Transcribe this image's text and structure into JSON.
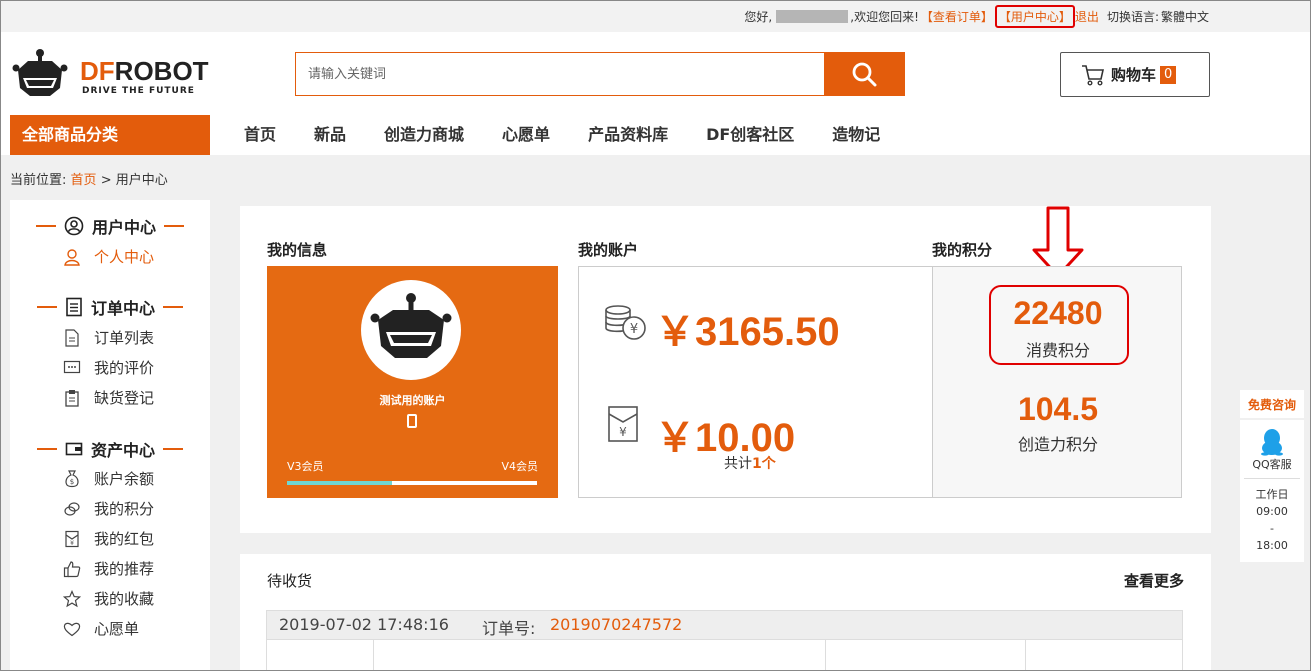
{
  "topbar": {
    "greeting": "您好,",
    "welcome": ",欢迎您回来!",
    "view_orders": "【查看订单】",
    "user_center": "【用户中心】",
    "logout": "退出",
    "switch_lang": "切换语言:",
    "lang": "繁體中文"
  },
  "header": {
    "logo_df": "DF",
    "logo_robot": "ROBOT",
    "logo_tagline": "DRIVE THE FUTURE",
    "search_placeholder": "请输入关键词",
    "cart_label": "购物车",
    "cart_count": "0"
  },
  "nav": {
    "category": "全部商品分类",
    "items": [
      "首页",
      "新品",
      "创造力商城",
      "心愿单",
      "产品资料库",
      "DF创客社区",
      "造物记"
    ]
  },
  "breadcrumb": {
    "prefix": "当前位置:",
    "home": "首页",
    "sep": ">",
    "current": "用户中心"
  },
  "sidebar": {
    "user_center": {
      "title": "用户中心",
      "items": [
        "个人中心"
      ]
    },
    "order_center": {
      "title": "订单中心",
      "items": [
        "订单列表",
        "我的评价",
        "缺货登记"
      ]
    },
    "asset_center": {
      "title": "资产中心",
      "items": [
        "账户余额",
        "我的积分",
        "我的红包",
        "我的推荐",
        "我的收藏",
        "心愿单"
      ]
    }
  },
  "my_info": {
    "title": "我的信息",
    "account_name": "测试用的账户",
    "level_current": "V3会员",
    "level_next": "V4会员",
    "level_progress_fraction": 0.42
  },
  "my_account": {
    "title": "我的账户",
    "balance": "￥3165.50",
    "coupon_amount": "￥10.00",
    "coupon_total_prefix": "共计",
    "coupon_count": "1个"
  },
  "my_points": {
    "title": "我的积分",
    "consume_points": "22480",
    "consume_label": "消费积分",
    "creative_points": "104.5",
    "creative_label": "创造力积分"
  },
  "pending": {
    "title": "待收货",
    "more": "查看更多",
    "order_time": "2019-07-02 17:48:16",
    "order_no_label": "订单号:",
    "order_no": "2019070247572"
  },
  "consult": {
    "title": "免费咨询",
    "qq_label": "QQ客服",
    "workday": "工作日",
    "start": "09:00",
    "dash": "-",
    "end": "18:00"
  },
  "colors": {
    "brand_orange": "#e35c0c",
    "highlight_red": "#e00000",
    "progress_teal": "#6fd6d1"
  }
}
